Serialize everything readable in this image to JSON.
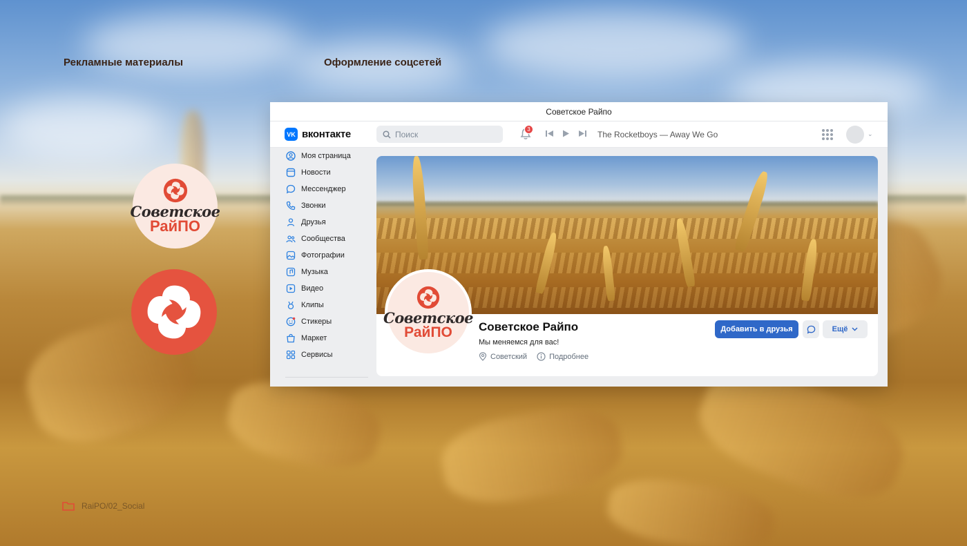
{
  "section_titles": {
    "left": "Рекламные материалы",
    "right": "Оформление соцсетей"
  },
  "brand": {
    "line1": "Советское",
    "line2": "РайПО",
    "red": "#e5533f",
    "blush": "#fbe9e2"
  },
  "folder_path": "RaiPO/02_Social",
  "window": {
    "title": "Советское Райпо"
  },
  "vk": {
    "logo_mark": "VK",
    "logo_text": "вконтакте",
    "search_placeholder": "Поиск",
    "notification_count": "3",
    "now_playing": "The Rocketboys — Away We Go",
    "accent": "#0077ff"
  },
  "sidebar": {
    "items": [
      {
        "label": "Моя страница",
        "icon": "user-circle-icon"
      },
      {
        "label": "Новости",
        "icon": "news-icon"
      },
      {
        "label": "Мессенджер",
        "icon": "message-icon"
      },
      {
        "label": "Звонки",
        "icon": "phone-icon"
      },
      {
        "label": "Друзья",
        "icon": "friends-icon"
      },
      {
        "label": "Сообщества",
        "icon": "communities-icon"
      },
      {
        "label": "Фотографии",
        "icon": "photo-icon"
      },
      {
        "label": "Музыка",
        "icon": "music-icon"
      },
      {
        "label": "Видео",
        "icon": "video-icon"
      },
      {
        "label": "Клипы",
        "icon": "clips-icon"
      },
      {
        "label": "Стикеры",
        "icon": "sticker-icon"
      },
      {
        "label": "Маркет",
        "icon": "market-icon"
      },
      {
        "label": "Сервисы",
        "icon": "services-icon"
      }
    ]
  },
  "profile": {
    "name": "Советское Райпо",
    "status": "Мы меняемся для вас!",
    "location": "Советский",
    "details_link": "Подробнее",
    "add_friend_label": "Добавить в друзья",
    "more_label": "Ещё"
  }
}
